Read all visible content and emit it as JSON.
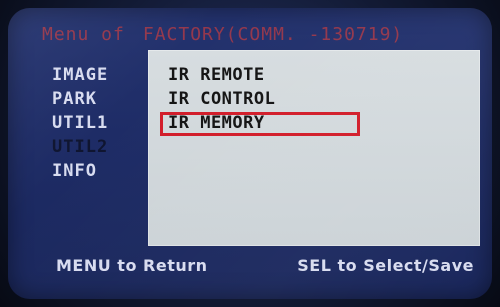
{
  "header": {
    "menu_label": "Menu of",
    "model_code": "FACTORY(COMM. -130719)"
  },
  "sidebar": {
    "items": [
      {
        "label": "IMAGE",
        "state": "normal"
      },
      {
        "label": "PARK",
        "state": "normal"
      },
      {
        "label": "UTIL1",
        "state": "normal"
      },
      {
        "label": "UTIL2",
        "state": "disabled"
      },
      {
        "label": "INFO",
        "state": "normal"
      }
    ]
  },
  "panel": {
    "items": [
      "IR REMOTE",
      "IR CONTROL",
      "IR MEMORY"
    ],
    "selected_index": 2
  },
  "footer": {
    "left_hint": "MENU to Return",
    "right_hint": "SEL to Select/Save"
  },
  "colors": {
    "screen_blue": "#1e2c66",
    "panel_gray": "#d0d6d9",
    "highlight_red": "#d21d2a",
    "menu_text": "#d8dcf0",
    "header_red": "#d23c3c"
  }
}
